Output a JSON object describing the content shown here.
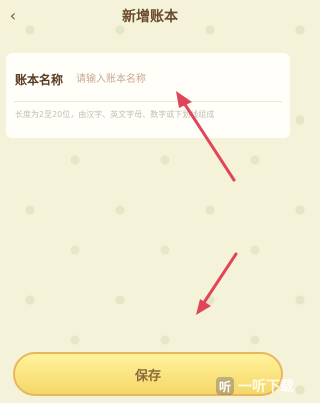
{
  "header": {
    "title": "新增账本",
    "back_icon": "chevron-left-icon"
  },
  "form": {
    "label": "账本名称",
    "placeholder": "请输入账本名称",
    "value": "",
    "hint": "长度为2至20位，由汉字、英文字母、数字或下划线组成"
  },
  "save_label": "保存",
  "watermark": {
    "text": "一听下载",
    "logo_glyph": "听"
  },
  "colors": {
    "accent": "#e8b65c",
    "background": "#f4f2d8",
    "arrow": "#e0455a"
  }
}
